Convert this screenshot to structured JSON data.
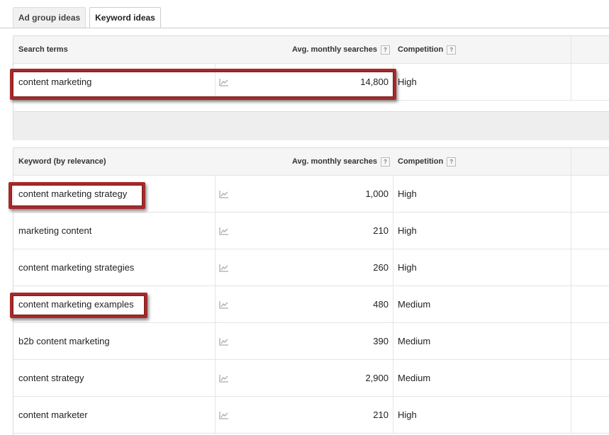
{
  "tabs": [
    {
      "label": "Ad group ideas",
      "active": false
    },
    {
      "label": "Keyword ideas",
      "active": true
    }
  ],
  "search_terms_table": {
    "headers": {
      "keyword": "Search terms",
      "avg": "Avg. monthly searches",
      "competition": "Competition",
      "help": "?"
    },
    "rows": [
      {
        "keyword": "content marketing",
        "avg": "14,800",
        "competition": "High",
        "highlighted": true
      }
    ]
  },
  "keyword_table": {
    "headers": {
      "keyword": "Keyword (by relevance)",
      "avg": "Avg. monthly searches",
      "competition": "Competition",
      "help": "?"
    },
    "rows": [
      {
        "keyword": "content marketing strategy",
        "avg": "1,000",
        "competition": "High",
        "highlighted": true
      },
      {
        "keyword": "marketing content",
        "avg": "210",
        "competition": "High",
        "highlighted": false
      },
      {
        "keyword": "content marketing strategies",
        "avg": "260",
        "competition": "High",
        "highlighted": false
      },
      {
        "keyword": "content marketing examples",
        "avg": "480",
        "competition": "Medium",
        "highlighted": true
      },
      {
        "keyword": "b2b content marketing",
        "avg": "390",
        "competition": "Medium",
        "highlighted": false
      },
      {
        "keyword": "content strategy",
        "avg": "2,900",
        "competition": "Medium",
        "highlighted": false
      },
      {
        "keyword": "content marketer",
        "avg": "210",
        "competition": "High",
        "highlighted": false
      }
    ]
  },
  "colors": {
    "highlight_border": "#a52a2a",
    "header_bg": "#f5f5f5",
    "trend_icon": "#aaaaaa"
  },
  "icons": {
    "trend": "trend-chart-icon",
    "help": "help-question-icon"
  }
}
